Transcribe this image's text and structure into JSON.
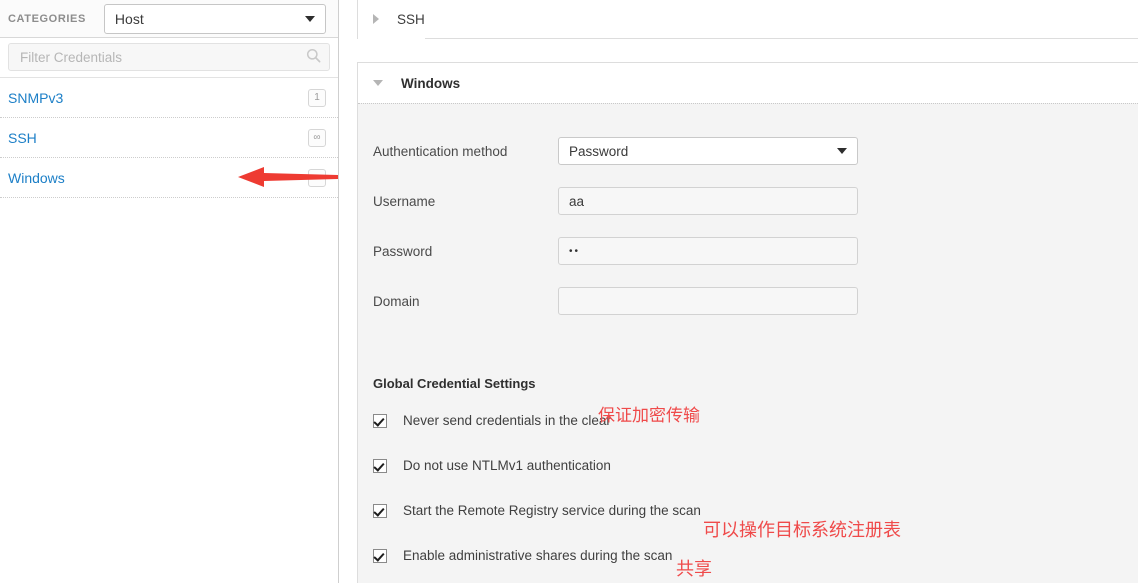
{
  "sidebar": {
    "categories_label": "CATEGORIES",
    "category_select": {
      "value": "Host",
      "icon": "chevron-down-icon"
    },
    "filter": {
      "placeholder": "Filter Credentials",
      "value": "",
      "icon": "search-icon"
    },
    "credentials": [
      {
        "name": "SNMPv3",
        "badge": "1"
      },
      {
        "name": "SSH",
        "badge": "∞"
      },
      {
        "name": "Windows",
        "badge": "∞"
      }
    ]
  },
  "main": {
    "panels": [
      {
        "title": "SSH",
        "expanded": false,
        "icon": "triangle-right-icon"
      },
      {
        "title": "Windows",
        "expanded": true,
        "icon": "triangle-down-icon"
      }
    ],
    "windows_form": {
      "auth_method": {
        "label": "Authentication method",
        "value": "Password",
        "icon": "chevron-down-icon"
      },
      "username": {
        "label": "Username",
        "value": "aa",
        "placeholder": ""
      },
      "password": {
        "label": "Password",
        "value": "••",
        "placeholder": ""
      },
      "domain": {
        "label": "Domain",
        "value": "",
        "placeholder": ""
      }
    },
    "global_settings": {
      "title": "Global Credential Settings",
      "options": [
        {
          "label": "Never send credentials in the clear",
          "checked": true
        },
        {
          "label": "Do not use NTLMv1 authentication",
          "checked": true
        },
        {
          "label": "Start the Remote Registry service during the scan",
          "checked": true
        },
        {
          "label": "Enable administrative shares during the scan",
          "checked": true
        }
      ]
    }
  },
  "annotations": {
    "arrow_color": "#ee3b32",
    "note_color": "#ef4a4a",
    "notes": [
      "保证加密传输",
      "可以操作目标系统注册表",
      "共享"
    ]
  },
  "colors": {
    "link": "#1c7fc7",
    "panel_body": "#f4f4f4",
    "border": "#dddddd"
  }
}
